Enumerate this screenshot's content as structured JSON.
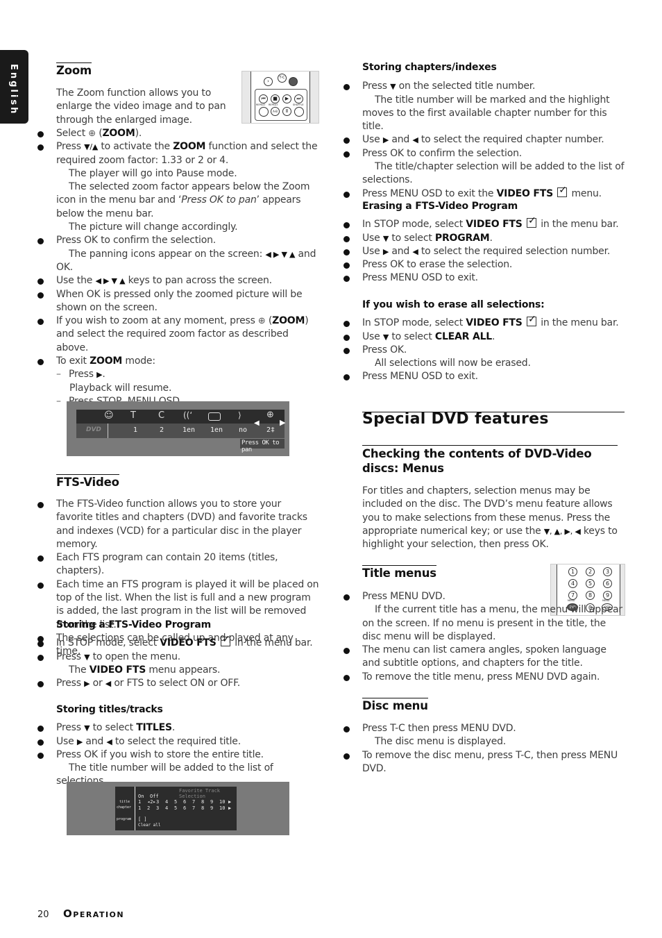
{
  "side_tab": {
    "label": "English"
  },
  "left": {
    "zoom": {
      "heading": "Zoom",
      "intro": "The Zoom function allows you to enlarge the video image and to pan through the enlarged image.",
      "b1_pre": "Select ",
      "b1_bold": "ZOOM",
      "b1_post": ").",
      "b2_pre": "Press ",
      "b2_keys": "▼/▲",
      "b2_mid": " to activate the ",
      "b2_bold": "ZOOM",
      "b2_post": " function and select the required zoom factor: 1.33 or 2 or 4.",
      "b2_n1": "The player will go into Pause mode.",
      "b2_n2_pre": "The selected zoom factor appears below the Zoom icon in the menu bar and ‘",
      "b2_n2_it": "Press OK to pan",
      "b2_n2_post": "’ appears below the menu bar.",
      "b2_n3": "The picture will change accordingly.",
      "b3": "Press OK to confirm the selection.",
      "b3_n1_pre": "The panning icons appear on the screen: ",
      "b3_n1_keys": "◀ ▶ ▼ ▲",
      "b3_n1_post": " and OK.",
      "b4_pre": "Use the ",
      "b4_keys": "◀ ▶ ▼ ▲",
      "b4_post": " keys to pan across the screen.",
      "b5": "When OK is pressed only the zoomed picture will be shown on the screen.",
      "b6_pre": "If you wish to zoom at any moment, press ",
      "b6_bold": "ZOOM",
      "b6_post": ") and select the required zoom factor as described above.",
      "b7_pre": "To exit ",
      "b7_bold": "ZOOM",
      "b7_post": " mode:",
      "d1_pre": "Press ",
      "d1_key": "▶",
      "d1_post": ".",
      "d1_note": "Playback will resume.",
      "d2": "Press STOP, MENU OSD."
    },
    "osd_zoom": {
      "logo": "DVD",
      "values": [
        "1",
        "2",
        "1en",
        "1en",
        "no",
        "2‡"
      ],
      "hint": "Press OK to pan"
    },
    "fts": {
      "heading": "FTS-Video",
      "b1": "The FTS-Video function allows you to store your favorite titles and chapters (DVD) and favorite tracks and indexes (VCD) for a particular disc in the player memory.",
      "b2": "Each FTS program can contain 20 items (titles, chapters).",
      "b3": "Each time an FTS program is played it will be placed on top of the list. When the list is full and a new program is added, the last program in the list will be removed from the list.",
      "b4": "The selections can be called up and played at any time."
    },
    "storing_program": {
      "heading": "Storing a FTS-Video Program",
      "b1_pre": "In STOP mode, select ",
      "b1_bold": "VIDEO FTS",
      "b1_post": " in the menu bar.",
      "b2_pre": "Press ",
      "b2_key": "▼",
      "b2_post": " to open the menu.",
      "b2_n_pre": "The ",
      "b2_n_bold": "VIDEO FTS",
      "b2_n_post": " menu appears.",
      "b3_pre": "Press ",
      "b3_k1": "▶",
      "b3_mid": " or ",
      "b3_k2": "◀",
      "b3_post": " or FTS to select ON or OFF."
    },
    "storing_titles": {
      "heading": "Storing titles/tracks",
      "b1_pre": "Press ",
      "b1_key": "▼",
      "b1_mid": " to select ",
      "b1_bold": "TITLES",
      "b1_post": ".",
      "b2_pre": "Use ",
      "b2_k1": "▶",
      "b2_mid": " and ",
      "b2_k2": "◀",
      "b2_post": " to select the required title.",
      "b3": "Press OK if you wish to store the entire title.",
      "b3_n": "The title number will be added to the list of selections."
    },
    "osd_fts": {
      "title": "Favorite Track Selection",
      "on": "On",
      "off": "Off",
      "row_title": "title",
      "row_chapter": "chapter",
      "row_program": "program",
      "title_nums": [
        "1",
        "◂2▸",
        "3",
        "4",
        "5",
        "6",
        "7",
        "8",
        "9",
        "10",
        "▶"
      ],
      "chapter_nums": [
        "1",
        "2",
        "3",
        "4",
        "5",
        "6",
        "7",
        "8",
        "9",
        "10",
        "▶"
      ],
      "program_val": "[ ]",
      "clear_all": "Clear all"
    }
  },
  "right": {
    "storing_chapters": {
      "heading": "Storing chapters/indexes",
      "b1_pre": "Press ",
      "b1_key": "▼",
      "b1_post": " on the selected title number.",
      "b1_n": "The title number will be marked and the highlight moves to the first available chapter number for this title.",
      "b2_pre": "Use ",
      "b2_k1": "▶",
      "b2_mid": " and ",
      "b2_k2": "◀",
      "b2_post": " to select the required chapter number.",
      "b3": "Press OK to confirm the selection.",
      "b3_n": "The title/chapter selection will be added to the list of selections.",
      "b4_pre": "Press MENU OSD to exit the ",
      "b4_bold": "VIDEO FTS",
      "b4_post": " menu."
    },
    "erasing": {
      "heading": "Erasing a FTS-Video Program",
      "b1_pre": "In STOP mode, select ",
      "b1_bold": "VIDEO FTS",
      "b1_post": " in the menu bar.",
      "b2_pre": "Use ",
      "b2_key": "▼",
      "b2_mid": " to select ",
      "b2_bold": "PROGRAM",
      "b2_post": ".",
      "b3_pre": "Use ",
      "b3_k1": "▶",
      "b3_mid": " and ",
      "b3_k2": "◀",
      "b3_post": " to select the required selection number.",
      "b4": "Press OK to erase the selection.",
      "b5": "Press MENU OSD to exit."
    },
    "erase_all": {
      "heading": "If you wish to erase all selections:",
      "b1_pre": "In STOP mode, select ",
      "b1_bold": "VIDEO FTS",
      "b1_post": " in the menu bar.",
      "b2_pre": "Use ",
      "b2_key": "▼",
      "b2_mid": " to select ",
      "b2_bold": "CLEAR ALL",
      "b2_post": ".",
      "b3": "Press OK.",
      "b3_n": "All selections will now be erased.",
      "b4": "Press MENU OSD to exit."
    },
    "special": {
      "title": "Special DVD features",
      "sub_heading": "Checking the contents of DVD-Video discs: Menus",
      "para_pre": "For titles and chapters, selection menus may be included on the disc. The DVD’s menu feature allows you to make selections from these menus. Press the appropriate numerical key; or use the ",
      "para_keys": "▼, ▲, ▶, ◀",
      "para_post": " keys to highlight your selection, then press OK."
    },
    "title_menus": {
      "heading": "Title menus",
      "b1": "Press MENU DVD.",
      "b1_n": "If the current title has a menu, the menu will appear on the screen. If no menu is present in the title, the disc menu will be displayed.",
      "b2": "The menu can list camera angles, spoken language and subtitle options, and chapters for the title.",
      "b3": "To remove the title menu, press MENU DVD again."
    },
    "disc_menu": {
      "heading": "Disc menu",
      "b1": "Press T-C then press MENU DVD.",
      "b1_n": "The disc menu is displayed.",
      "b2": "To remove the disc menu, press T-C, then press MENU DVD."
    },
    "keypad": {
      "keys": [
        "1",
        "2",
        "3",
        "4",
        "5",
        "6",
        "7",
        "8",
        "9",
        "0"
      ],
      "menu_label": "MENU",
      "dvd_label": "DVD",
      "osd_label": "OSD"
    }
  },
  "remote_zoom": {
    "tc": "T-C",
    "repeat1": "REPEAT",
    "repeat2": "REPEAT",
    "shuffle": "SHUFFLE",
    "ab": "A-B"
  },
  "footer": {
    "page_number": "20",
    "section": "Operation"
  }
}
